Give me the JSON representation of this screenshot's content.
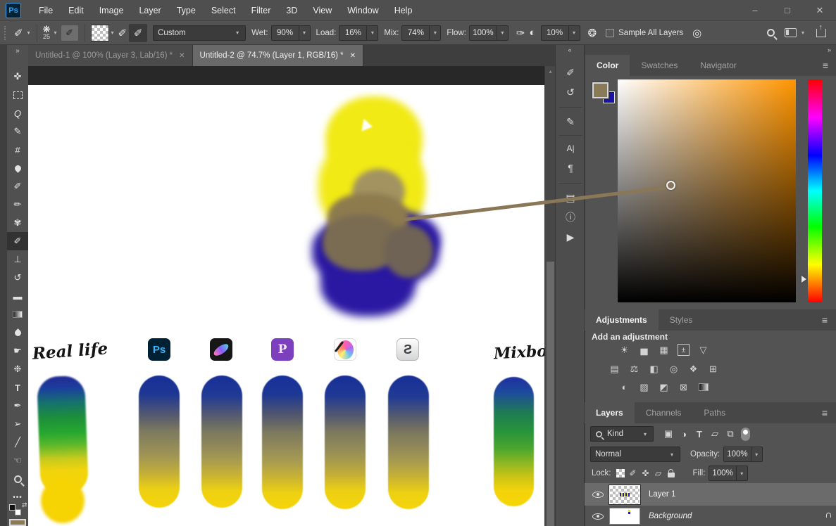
{
  "window": {
    "logo": "Ps",
    "controls": [
      {
        "name": "minimize",
        "glyph": "–"
      },
      {
        "name": "maximize",
        "glyph": "□"
      },
      {
        "name": "close",
        "glyph": "✕"
      }
    ]
  },
  "menus": [
    "File",
    "Edit",
    "Image",
    "Layer",
    "Type",
    "Select",
    "Filter",
    "3D",
    "View",
    "Window",
    "Help"
  ],
  "glyphs": {
    "chevron": "▾",
    "close": "✕",
    "menu": "≡",
    "collapse_right": "»",
    "collapse_left": "«",
    "scroll_up": "▴",
    "swap": "⇄",
    "airbrush": "✑",
    "pressure": "◐",
    "gear": "❂",
    "smoothing": "◎"
  },
  "options": {
    "brush_glyph": "❋",
    "brush_size": "25",
    "preset": "Custom",
    "wet_label": "Wet:",
    "wet": "90%",
    "load_label": "Load:",
    "load": "16%",
    "mix_label": "Mix:",
    "mix": "74%",
    "flow_label": "Flow:",
    "flow": "100%",
    "smoothing": "10%",
    "sample_all_layers": "Sample All Layers"
  },
  "tabs": [
    {
      "title": "Untitled-1 @ 100% (Layer 3, Lab/16) *"
    },
    {
      "title": "Untitled-2 @ 74.7% (Layer 1, RGB/16) *"
    }
  ],
  "toolbar": {
    "tools": [
      {
        "name": "move",
        "glyph": "✜"
      },
      {
        "name": "rectangular-marquee",
        "glyph": ""
      },
      {
        "name": "lasso",
        "glyph": "Q"
      },
      {
        "name": "quick-selection",
        "glyph": "✎"
      },
      {
        "name": "crop",
        "glyph": "#"
      },
      {
        "name": "eyedropper",
        "glyph": ""
      },
      {
        "name": "brush",
        "glyph": "✐"
      },
      {
        "name": "pencil",
        "glyph": "✏"
      },
      {
        "name": "color-replacement",
        "glyph": "✾"
      },
      {
        "name": "mixer-brush",
        "glyph": "✐"
      },
      {
        "name": "clone-stamp",
        "glyph": "⊥"
      },
      {
        "name": "history-brush",
        "glyph": "↺"
      },
      {
        "name": "eraser",
        "glyph": "▬"
      },
      {
        "name": "gradient",
        "glyph": ""
      },
      {
        "name": "blur",
        "glyph": ""
      },
      {
        "name": "smudge",
        "glyph": "☛"
      },
      {
        "name": "sponge",
        "glyph": "❉"
      },
      {
        "name": "type",
        "glyph": "T"
      },
      {
        "name": "pen",
        "glyph": "✒"
      },
      {
        "name": "path-selection",
        "glyph": "➢"
      },
      {
        "name": "line",
        "glyph": "╱"
      },
      {
        "name": "hand",
        "glyph": "☜"
      },
      {
        "name": "zoom",
        "glyph": ""
      },
      {
        "name": "edit-toolbar",
        "glyph": "•••"
      }
    ]
  },
  "panel_strip": [
    {
      "name": "brush-settings",
      "glyph": "✐"
    },
    {
      "name": "history",
      "glyph": "↺"
    },
    {
      "name": "brushes",
      "glyph": "✎"
    },
    {
      "name": "character",
      "glyph": "A|"
    },
    {
      "name": "paragraph",
      "glyph": "¶"
    },
    {
      "name": "properties",
      "glyph": "▤"
    },
    {
      "name": "info",
      "glyph": "ⓘ"
    },
    {
      "name": "actions",
      "glyph": "▶"
    }
  ],
  "color_panel": {
    "tabs": [
      "Color",
      "Swatches",
      "Navigator"
    ],
    "active_tab": "Color",
    "foreground_color": "#8b7a57",
    "background_color": "#1812a8",
    "field_hue_color": "#ff9500"
  },
  "adjustments": {
    "tabs": [
      "Adjustments",
      "Styles"
    ],
    "active_tab": "Adjustments",
    "heading": "Add an adjustment",
    "rows": [
      [
        {
          "name": "brightness-contrast",
          "glyph": "☀"
        },
        {
          "name": "levels",
          "glyph": "▅"
        },
        {
          "name": "curves",
          "glyph": "▦"
        },
        {
          "name": "exposure",
          "glyph": "±"
        },
        {
          "name": "vibrance",
          "glyph": "▽"
        }
      ],
      [
        {
          "name": "hue-saturation",
          "glyph": "▤"
        },
        {
          "name": "color-balance",
          "glyph": "⚖"
        },
        {
          "name": "black-white",
          "glyph": "◧"
        },
        {
          "name": "photo-filter",
          "glyph": "◎"
        },
        {
          "name": "channel-mixer",
          "glyph": "❖"
        },
        {
          "name": "color-lookup",
          "glyph": "⊞"
        }
      ],
      [
        {
          "name": "invert",
          "glyph": "◐"
        },
        {
          "name": "posterize",
          "glyph": "▨"
        },
        {
          "name": "threshold",
          "glyph": "◩"
        },
        {
          "name": "selective-color",
          "glyph": "⊠"
        },
        {
          "name": "gradient-map",
          "glyph": ""
        }
      ]
    ]
  },
  "layers_panel": {
    "tabs": [
      "Layers",
      "Channels",
      "Paths"
    ],
    "active_tab": "Layers",
    "kind_label": "Kind",
    "filter_icons": [
      {
        "name": "filter-image",
        "glyph": "▣"
      },
      {
        "name": "filter-adjustment",
        "glyph": "◑"
      },
      {
        "name": "filter-type",
        "glyph": "T"
      },
      {
        "name": "filter-shape",
        "glyph": "▱"
      },
      {
        "name": "filter-smart-object",
        "glyph": "⧉"
      }
    ],
    "blend_mode": "Normal",
    "opacity_label": "Opacity:",
    "opacity": "100%",
    "lock_label": "Lock:",
    "lock_icons": [
      {
        "name": "lock-transparency",
        "glyph": ""
      },
      {
        "name": "lock-paint",
        "glyph": "✐"
      },
      {
        "name": "lock-position",
        "glyph": "✜"
      },
      {
        "name": "lock-artboard",
        "glyph": "▱"
      },
      {
        "name": "lock-all",
        "glyph": ""
      }
    ],
    "fill_label": "Fill:",
    "fill": "100%",
    "rows": [
      {
        "name": "Layer 1",
        "selected": true,
        "locked": false
      },
      {
        "name": "Background",
        "selected": false,
        "locked": true
      }
    ]
  },
  "comparison": {
    "left_label": "Real life",
    "right_label": "Mixbox",
    "ps_label": "Ps",
    "ip_label": "P",
    "csp_glyph": "Ƨ",
    "apps": [
      "Photoshop",
      "Procreate",
      "Infinite Painter",
      "Krita",
      "Clip Studio Paint"
    ],
    "paint_colors": {
      "blue": "#1c2f9b",
      "yellow": "#f5d40c",
      "digital_mix": "#8d8559",
      "real_mix": "#27a030"
    }
  },
  "canvas": {
    "blob_yellow": "#f2ea15",
    "blob_blue": "#2a18a2",
    "mix_brown": "#8b7a57",
    "stroke_color": "#8a7757"
  }
}
